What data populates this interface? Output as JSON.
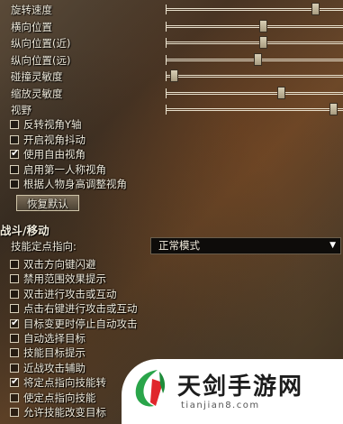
{
  "sliders": [
    {
      "label": "旋转速度",
      "value": 0.86
    },
    {
      "label": "横向位置",
      "value": 0.55
    },
    {
      "label": "纵向位置(近)",
      "value": 0.55
    },
    {
      "label": "纵向位置(远)",
      "value": 0.52
    },
    {
      "label": "碰撞灵敏度",
      "value": 0.02
    },
    {
      "label": "缩放灵敏度",
      "value": 0.66
    },
    {
      "label": "视野",
      "value": 0.97
    }
  ],
  "camera_options": [
    {
      "label": "反转视角Y轴",
      "checked": false
    },
    {
      "label": "开启视角抖动",
      "checked": false
    },
    {
      "label": "使用自由视角",
      "checked": true
    },
    {
      "label": "启用第一人称视角",
      "checked": false
    },
    {
      "label": "根据人物身高调整视角",
      "checked": false
    }
  ],
  "restore_button": "恢复默认",
  "combat_section": {
    "title": "战斗/移动",
    "dropdown_label": "技能定点指向:",
    "dropdown_value": "正常模式",
    "options": [
      {
        "label": "双击方向键闪避",
        "checked": false
      },
      {
        "label": "禁用范围效果提示",
        "checked": false
      },
      {
        "label": "双击进行攻击或互动",
        "checked": false
      },
      {
        "label": "点击右键进行攻击或互动",
        "checked": false
      },
      {
        "label": "目标变更时停止自动攻击",
        "checked": true
      },
      {
        "label": "自动选择目标",
        "checked": false
      },
      {
        "label": "技能目标提示",
        "checked": false
      },
      {
        "label": "近战攻击辅助",
        "checked": false
      },
      {
        "label": "将定点指向技能转",
        "checked": true
      },
      {
        "label": "使定点指向技能",
        "checked": false
      },
      {
        "label": "允许技能改变目标",
        "checked": false
      }
    ]
  },
  "watermark": {
    "title": "天剑手游网",
    "url": "tianjian8.com"
  }
}
